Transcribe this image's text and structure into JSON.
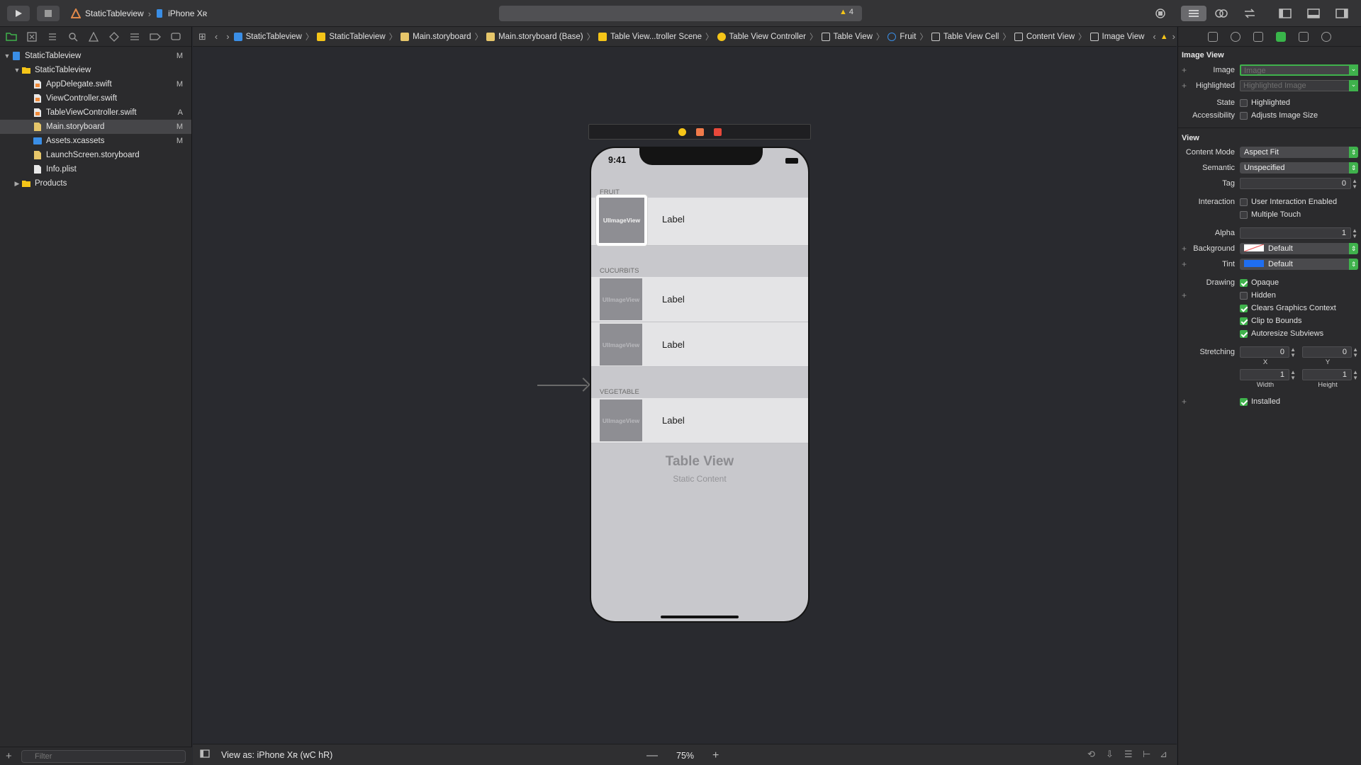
{
  "toolbar": {
    "scheme_name": "StaticTableview",
    "device_name": "iPhone Xʀ",
    "warning_count": "4"
  },
  "navigator": {
    "items": [
      {
        "label": "StaticTableview",
        "status": "M"
      },
      {
        "label": "StaticTableview",
        "status": ""
      },
      {
        "label": "AppDelegate.swift",
        "status": "M"
      },
      {
        "label": "ViewController.swift",
        "status": ""
      },
      {
        "label": "TableViewController.swift",
        "status": "A"
      },
      {
        "label": "Main.storyboard",
        "status": "M"
      },
      {
        "label": "Assets.xcassets",
        "status": "M"
      },
      {
        "label": "LaunchScreen.storyboard",
        "status": ""
      },
      {
        "label": "Info.plist",
        "status": ""
      },
      {
        "label": "Products",
        "status": ""
      }
    ],
    "filter_placeholder": "Filter"
  },
  "jumpbar": {
    "crumbs": [
      "StaticTableview",
      "StaticTableview",
      "Main.storyboard",
      "Main.storyboard (Base)",
      "Table View...troller Scene",
      "Table View Controller",
      "Table View",
      "Fruit",
      "Table View Cell",
      "Content View",
      "Image View"
    ]
  },
  "canvas": {
    "time": "9:41",
    "sections": [
      {
        "header": "FRUIT"
      },
      {
        "header": "CUCURBITS"
      },
      {
        "header": "VEGETABLE"
      }
    ],
    "image_placeholder": "UIImageView",
    "cell_label": "Label",
    "placeholder_title": "Table View",
    "placeholder_subtitle": "Static Content"
  },
  "bottombar": {
    "view_as": "View as: iPhone Xʀ (wC hR)",
    "zoom": "75%"
  },
  "inspector": {
    "image_view_title": "Image View",
    "image_label": "Image",
    "image_placeholder": "Image",
    "highlighted_label": "Highlighted",
    "highlighted_placeholder": "Highlighted Image",
    "state_label": "State",
    "state_option": "Highlighted",
    "accessibility_label": "Accessibility",
    "accessibility_option": "Adjusts Image Size",
    "view_title": "View",
    "content_mode_label": "Content Mode",
    "content_mode_value": "Aspect Fit",
    "semantic_label": "Semantic",
    "semantic_value": "Unspecified",
    "tag_label": "Tag",
    "tag_value": "0",
    "interaction_label": "Interaction",
    "interaction_opt1": "User Interaction Enabled",
    "interaction_opt2": "Multiple Touch",
    "alpha_label": "Alpha",
    "alpha_value": "1",
    "background_label": "Background",
    "background_value": "Default",
    "tint_label": "Tint",
    "tint_value": "Default",
    "drawing_label": "Drawing",
    "drawing_opts": [
      "Opaque",
      "Hidden",
      "Clears Graphics Context",
      "Clip to Bounds",
      "Autoresize Subviews"
    ],
    "stretching_label": "Stretching",
    "stretch_x": "0",
    "stretch_y": "0",
    "stretch_w": "1",
    "stretch_h": "1",
    "x_label": "X",
    "y_label": "Y",
    "width_label": "Width",
    "height_label": "Height",
    "installed_label": "Installed"
  },
  "colors": {
    "accent_green": "#3fb24c",
    "tint_blue": "#1f6ef0"
  }
}
